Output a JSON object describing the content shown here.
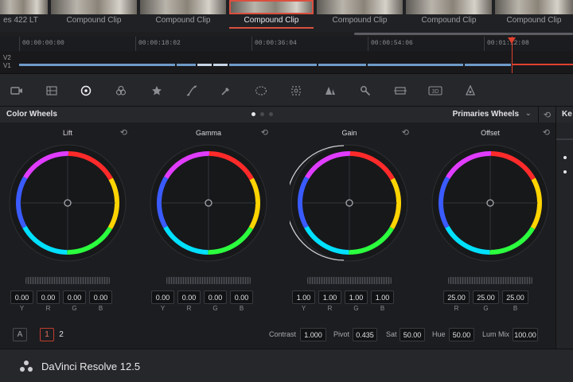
{
  "clip_strip": {
    "clips": [
      {
        "label": "es 422 LT"
      },
      {
        "label": "Compound Clip"
      },
      {
        "label": "Compound Clip"
      },
      {
        "label": "Compound Clip"
      },
      {
        "label": "Compound Clip"
      },
      {
        "label": "Compound Clip"
      },
      {
        "label": "Compound Clip"
      }
    ],
    "selected_index": 3
  },
  "timeline": {
    "timecodes": [
      "00:00:00:00",
      "00:00:18:02",
      "00:00:36:04",
      "00:00:54:06",
      "00:01:12:08"
    ],
    "tracks": [
      "V2",
      "V1"
    ]
  },
  "toolbar": {
    "tools": [
      "camera-icon",
      "grid-icon",
      "color-wheels-icon",
      "rgb-mixer-icon",
      "motion-effects-icon",
      "curves-icon",
      "qualifier-icon",
      "window-icon",
      "tracker-icon",
      "blur-icon",
      "key-icon",
      "sizing-icon",
      "3d-icon",
      "gallery-icon"
    ],
    "active_tool": "color-wheels-icon"
  },
  "panel": {
    "title": "Color Wheels",
    "mode": "Primaries Wheels",
    "page_dots": 3,
    "active_dot": 0
  },
  "wheels": [
    {
      "name": "Lift",
      "values": [
        "0.00",
        "0.00",
        "0.00",
        "0.00"
      ],
      "channels": [
        "Y",
        "R",
        "G",
        "B"
      ]
    },
    {
      "name": "Gamma",
      "values": [
        "0.00",
        "0.00",
        "0.00",
        "0.00"
      ],
      "channels": [
        "Y",
        "R",
        "G",
        "B"
      ]
    },
    {
      "name": "Gain",
      "values": [
        "1.00",
        "1.00",
        "1.00",
        "1.00"
      ],
      "channels": [
        "Y",
        "R",
        "G",
        "B"
      ]
    },
    {
      "name": "Offset",
      "values": [
        "25.00",
        "25.00",
        "25.00"
      ],
      "channels": [
        "R",
        "G",
        "B"
      ]
    }
  ],
  "bottom_controls": {
    "a_label": "A",
    "page1": "1",
    "page2": "2",
    "contrast_label": "Contrast",
    "contrast_value": "1.000",
    "pivot_label": "Pivot",
    "pivot_value": "0.435",
    "sat_label": "Sat",
    "sat_value": "50.00",
    "hue_label": "Hue",
    "hue_value": "50.00",
    "lummix_label": "Lum Mix",
    "lummix_value": "100.00"
  },
  "right_panel": {
    "title": "Ke"
  },
  "footer": {
    "app_name": "DaVinci Resolve 12.5"
  },
  "colors": {
    "accent_red": "#e0412f",
    "clip_blue": "#6e9bc9"
  }
}
